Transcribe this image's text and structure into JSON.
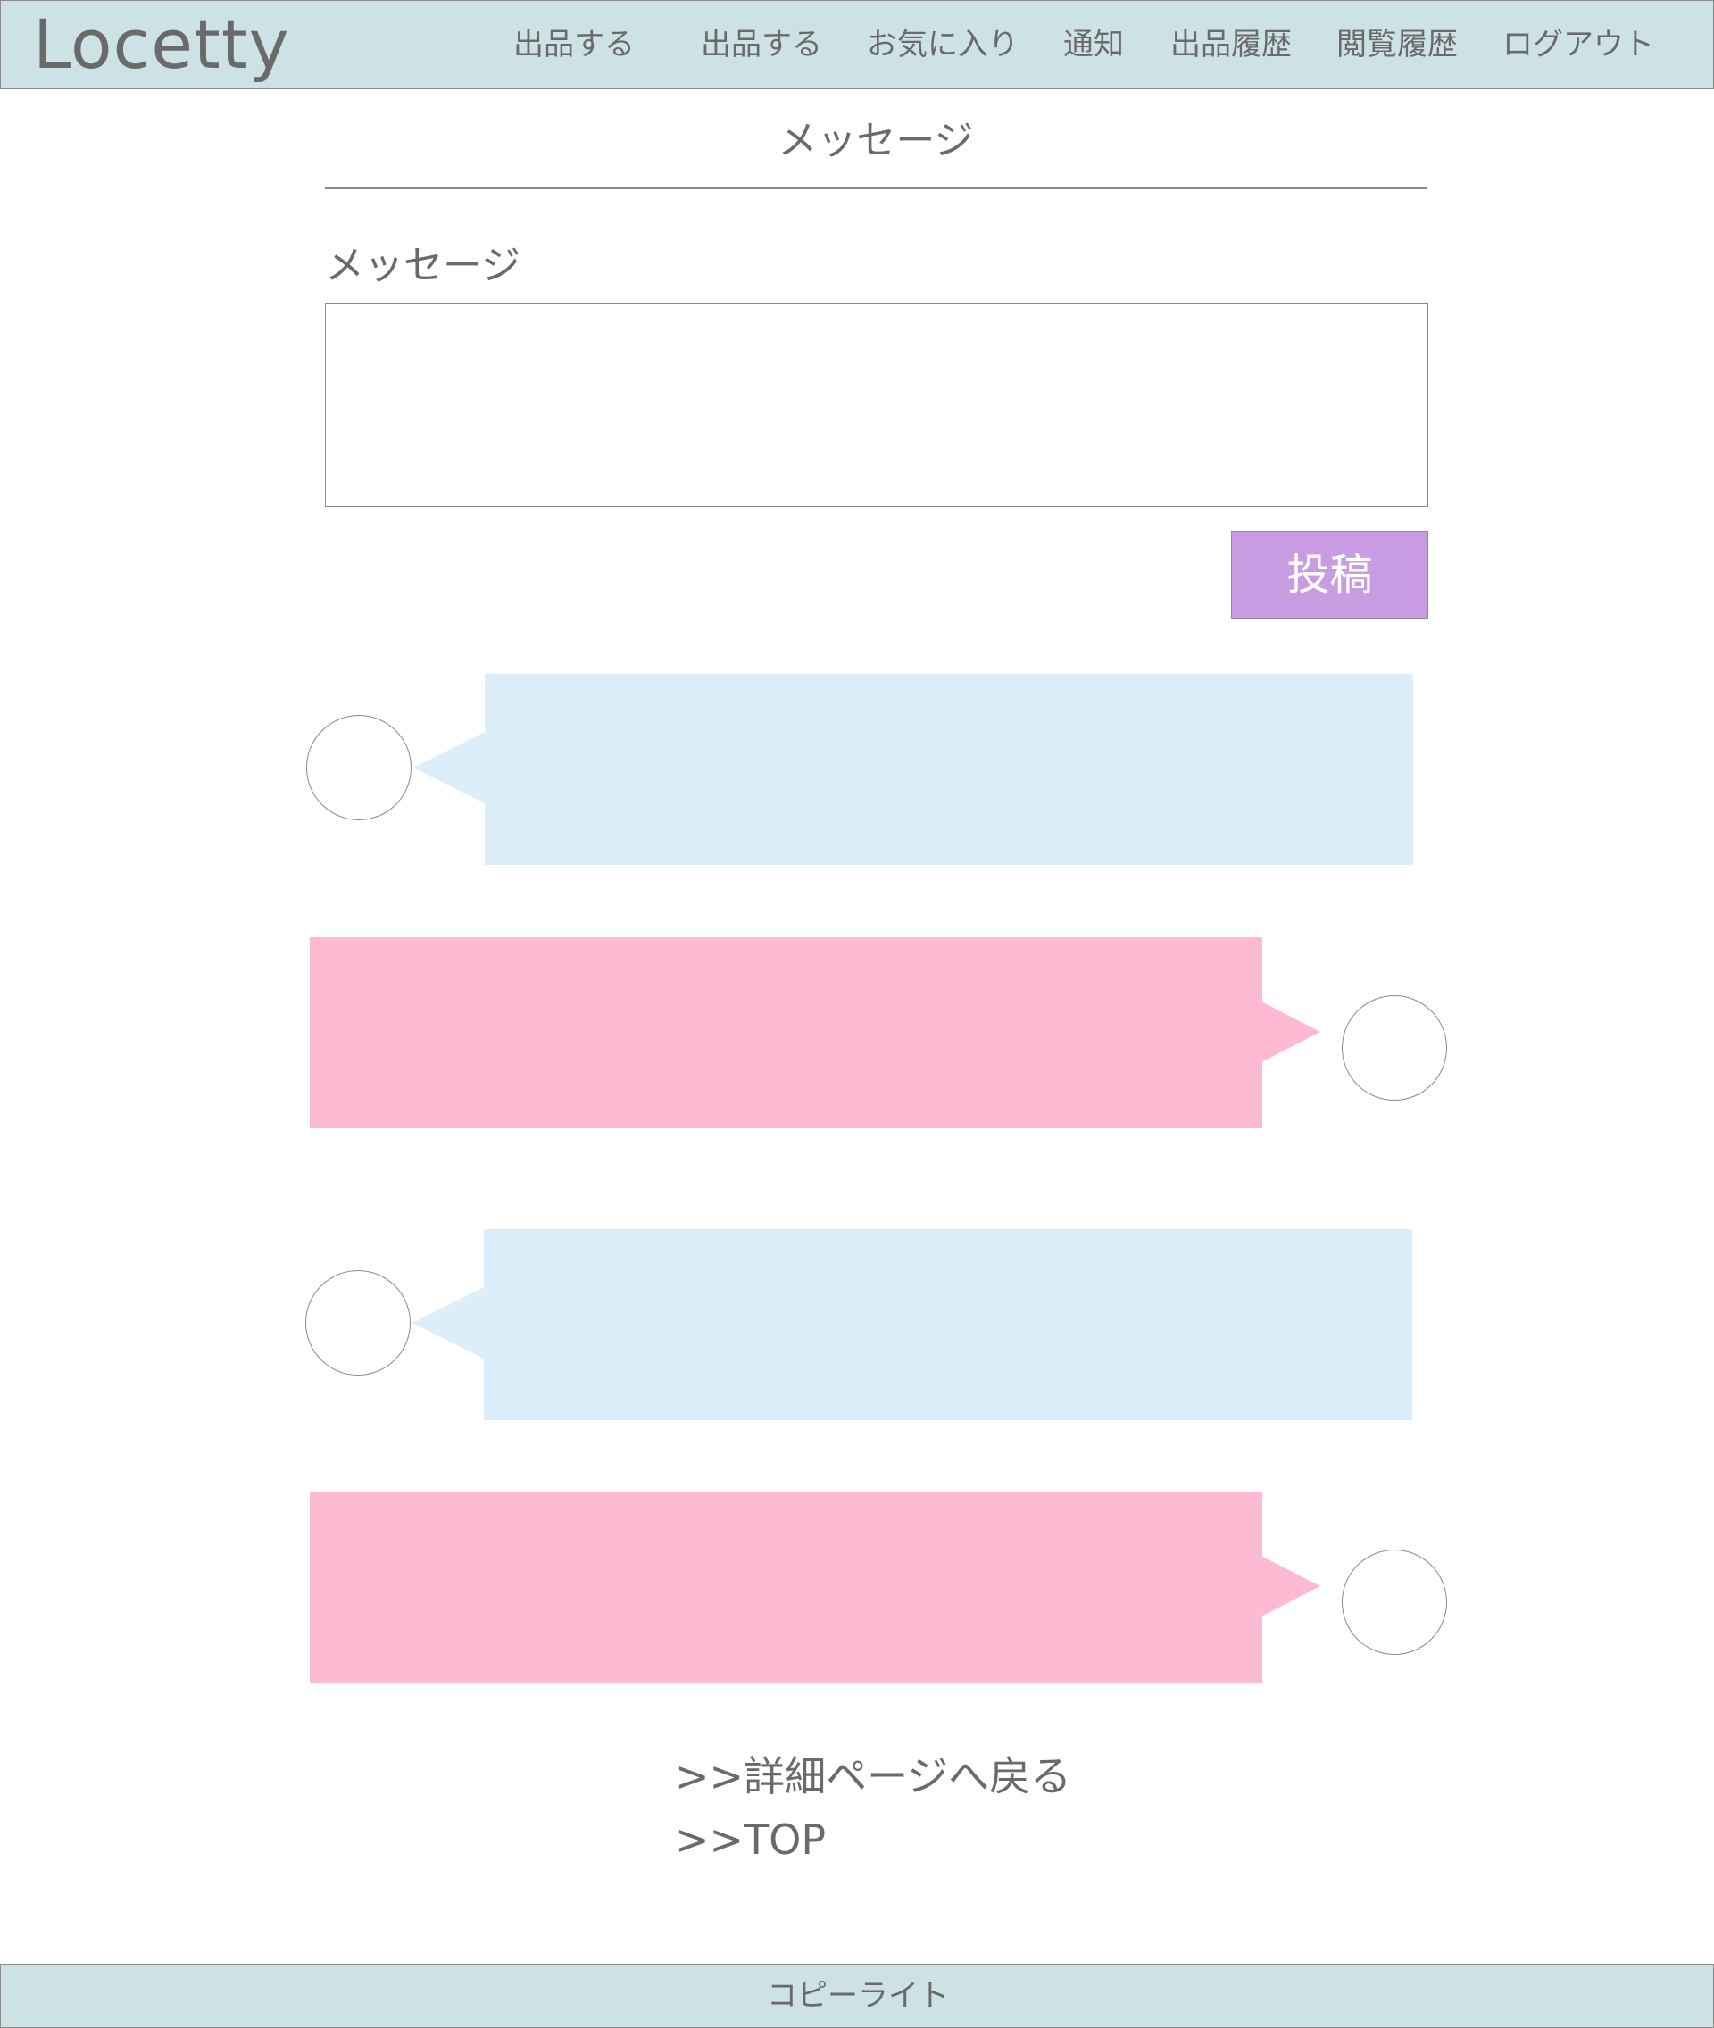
{
  "header": {
    "logo": "Locetty",
    "nav": [
      "出品する",
      "出品する",
      "お気に入り",
      "通知",
      "出品履歴",
      "閲覧履歴",
      "ログアウト"
    ]
  },
  "main": {
    "page_title": "メッセージ",
    "form": {
      "label": "メッセージ",
      "value": "",
      "placeholder": "",
      "submit_label": "投稿"
    },
    "messages": [
      {
        "side": "left",
        "text": ""
      },
      {
        "side": "right",
        "text": ""
      },
      {
        "side": "left",
        "text": ""
      },
      {
        "side": "right",
        "text": ""
      }
    ],
    "links": {
      "back_to_detail": ">>詳細ページへ戻る",
      "top": ">>TOP"
    }
  },
  "footer": {
    "copyright": "コピーライト"
  },
  "colors": {
    "header_bg": "#cde2e5",
    "button_bg": "#c99be3",
    "bubble_left": "#dbeef9",
    "bubble_right": "#fdbad2",
    "text": "#6a6a6a"
  }
}
